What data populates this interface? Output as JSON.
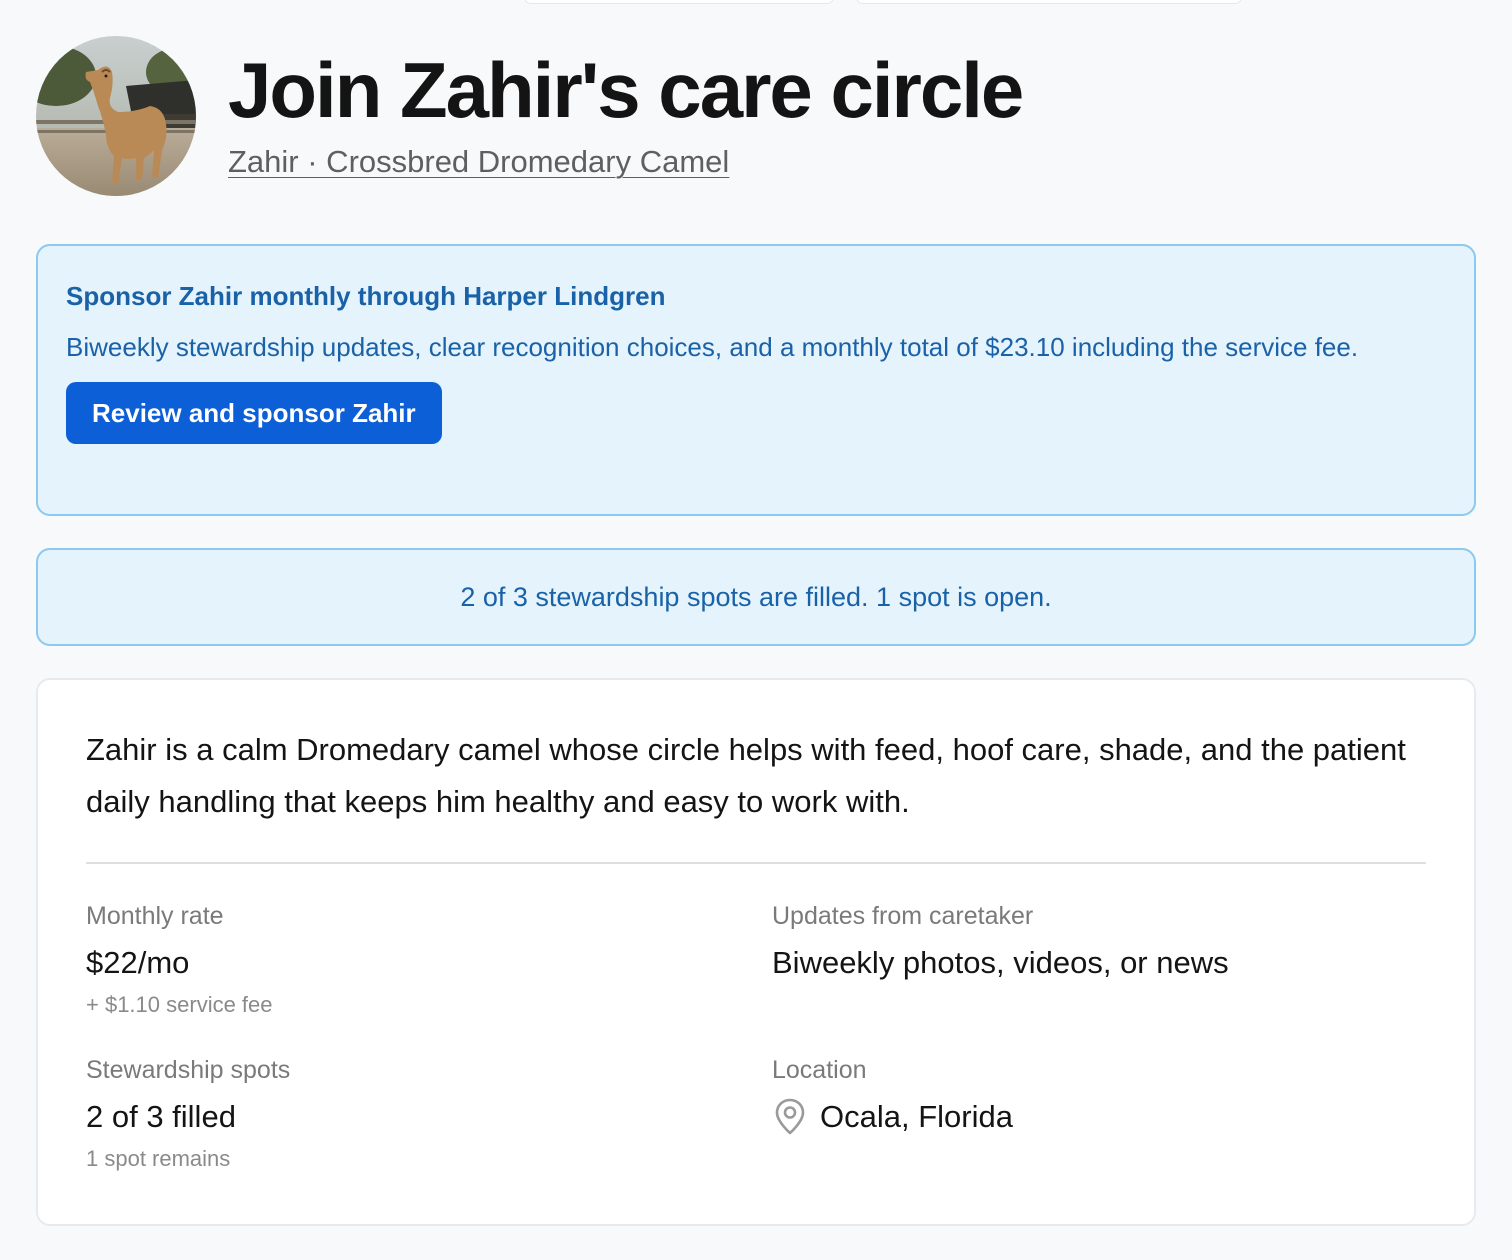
{
  "header": {
    "title": "Join Zahir's care circle",
    "subtitle": "Zahir · Crossbred Dromedary Camel",
    "avatar_icon": "camel-photo"
  },
  "sponsor": {
    "title": "Sponsor Zahir monthly through Harper Lindgren",
    "description": "Biweekly stewardship updates, clear recognition choices, and a monthly total of $23.10 including the service fee.",
    "button_label": "Review and sponsor Zahir"
  },
  "spots_banner": {
    "text": "2 of 3 stewardship spots are filled. 1 spot is open."
  },
  "details": {
    "description": "Zahir is a calm Dromedary camel whose circle helps with feed, hoof care, shade, and the patient daily handling that keeps him healthy and easy to work with.",
    "monthly_rate": {
      "label": "Monthly rate",
      "value": "$22/mo",
      "note": "+ $1.10 service fee"
    },
    "updates": {
      "label": "Updates from caretaker",
      "value": "Biweekly photos, videos, or news"
    },
    "spots": {
      "label": "Stewardship spots",
      "value": "2 of 3 filled",
      "note": "1 spot remains"
    },
    "location": {
      "label": "Location",
      "value": "Ocala, Florida",
      "icon": "map-pin-icon"
    }
  },
  "colors": {
    "accent": "#0d5fd8",
    "info_bg": "#e5f3fd",
    "info_border": "#8cc8f0",
    "info_text": "#1a62a8"
  }
}
